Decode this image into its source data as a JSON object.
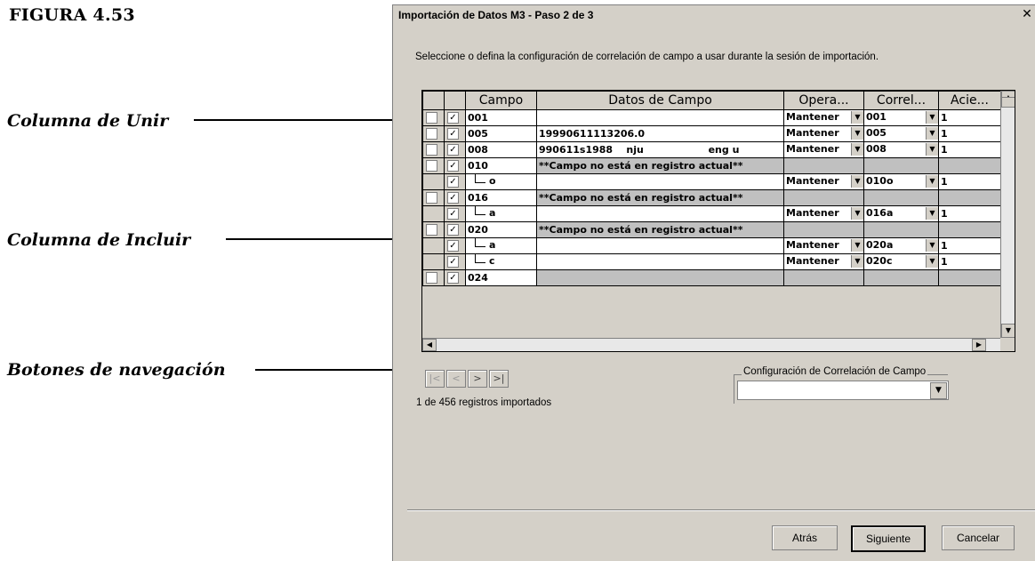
{
  "figure_label": "FIGURA 4.53",
  "annotations": {
    "unir": "Columna de Unir",
    "incluir": "Columna de Incluir",
    "navegacion": "Botones de navegación"
  },
  "dialog": {
    "title": "Importación de Datos M3 - Paso 2 de 3",
    "close_icon": "close-icon",
    "instruction": "Seleccione o defina la configuración de correlación de campo a usar durante la sesión de importación."
  },
  "grid": {
    "headers": {
      "campo": "Campo",
      "datos": "Datos de Campo",
      "operacion": "Opera...",
      "correlacion": "Correl...",
      "acierto": "Acie..."
    },
    "rows": [
      {
        "unir": true,
        "incluir": true,
        "campo": "001",
        "datos": "",
        "operacion": "Mantener",
        "correlacion": "001",
        "acierto": "1"
      },
      {
        "unir": true,
        "incluir": true,
        "campo": "005",
        "datos": "19990611113206.0",
        "operacion": "Mantener",
        "correlacion": "005",
        "acierto": "1"
      },
      {
        "unir": true,
        "incluir": true,
        "campo": "008",
        "datos": "990611s1988    nju                   eng u",
        "operacion": "Mantener",
        "correlacion": "008",
        "acierto": "1"
      },
      {
        "unir": true,
        "incluir": true,
        "campo": "010",
        "datos": "**Campo no está en registro actual**",
        "operacion": "",
        "correlacion": "",
        "acierto": ""
      },
      {
        "unir": false,
        "incluir": true,
        "sub": "o",
        "datos": "",
        "operacion": "Mantener",
        "correlacion": "010o",
        "acierto": "1"
      },
      {
        "unir": true,
        "incluir": true,
        "campo": "016",
        "datos": "**Campo no está en registro actual**",
        "operacion": "",
        "correlacion": "",
        "acierto": ""
      },
      {
        "unir": false,
        "incluir": true,
        "sub": "a",
        "datos": "",
        "operacion": "Mantener",
        "correlacion": "016a",
        "acierto": "1"
      },
      {
        "unir": true,
        "incluir": true,
        "campo": "020",
        "datos": "**Campo no está en registro actual**",
        "operacion": "",
        "correlacion": "",
        "acierto": ""
      },
      {
        "unir": false,
        "incluir": true,
        "sub": "a",
        "datos": "",
        "operacion": "Mantener",
        "correlacion": "020a",
        "acierto": "1"
      },
      {
        "unir": false,
        "incluir": true,
        "sub": "c",
        "datos": "",
        "operacion": "Mantener",
        "correlacion": "020c",
        "acierto": "1"
      },
      {
        "unir": true,
        "incluir": true,
        "campo": "024",
        "datos": "",
        "operacion": "",
        "correlacion": "",
        "acierto": ""
      }
    ],
    "checkmark": "✓"
  },
  "navigation": {
    "first": "|<",
    "prev": "<",
    "next": ">",
    "last": ">|",
    "records": "1 de 456 registros importados"
  },
  "config": {
    "label": "Configuración de Correlación de Campo",
    "value": ""
  },
  "buttons": {
    "back": "Atrás",
    "next": "Siguiente",
    "cancel": "Cancelar"
  }
}
